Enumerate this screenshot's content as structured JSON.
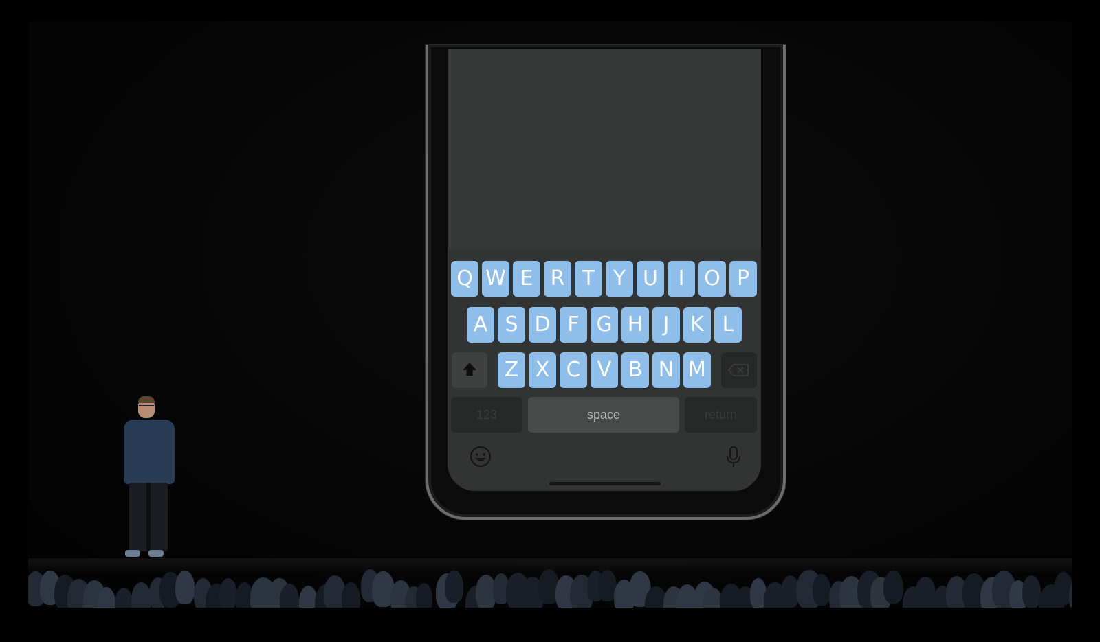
{
  "keyboard": {
    "row1": [
      "Q",
      "W",
      "E",
      "R",
      "T",
      "Y",
      "U",
      "I",
      "O",
      "P"
    ],
    "row2": [
      "A",
      "S",
      "D",
      "F",
      "G",
      "H",
      "J",
      "K",
      "L"
    ],
    "row3": [
      "Z",
      "X",
      "C",
      "V",
      "B",
      "N",
      "M"
    ],
    "numbers_label": "123",
    "space_label": "space",
    "return_label": "return"
  },
  "icons": {
    "shift": "shift-arrow-icon",
    "delete": "backspace-icon",
    "emoji": "emoji-face-icon",
    "dictation": "microphone-icon"
  },
  "colors": {
    "key_fill": "#8ebee9",
    "keyboard_background": "#323333",
    "screen_background": "#363737"
  }
}
